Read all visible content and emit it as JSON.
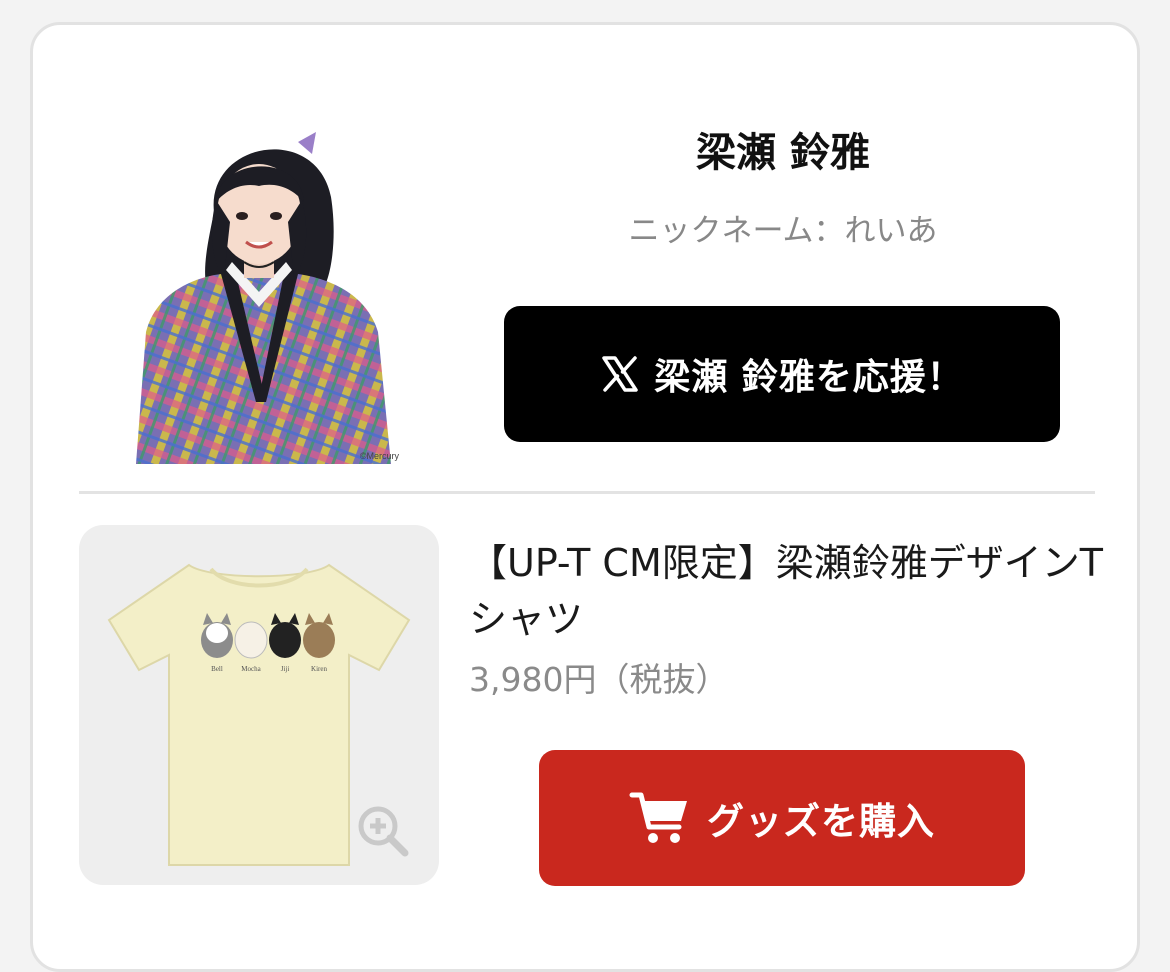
{
  "profile": {
    "name": "梁瀬 鈴雅",
    "nickname": "ニックネーム：れいあ",
    "photo_credit": "©Mercury",
    "cheer_button_label": "梁瀬 鈴雅を応援！",
    "cheer_icon": "x-logo-icon"
  },
  "product": {
    "title": "【UP-T CM限定】梁瀬鈴雅デザインTシャツ",
    "price": "3,980円（税抜）",
    "shirt_cat_names": [
      "Bell",
      "Mocha",
      "Jiji",
      "Kiren"
    ],
    "buy_button_label": "グッズを購入",
    "buy_icon": "cart-icon",
    "zoom_icon": "zoom-in-icon"
  },
  "colors": {
    "cheer_button_bg": "#000000",
    "buy_button_bg": "#c9281e",
    "price_text": "#8a8a8a",
    "nickname_text": "#888888",
    "shirt_color": "#f3efc8",
    "product_bg": "#eeeeee"
  }
}
